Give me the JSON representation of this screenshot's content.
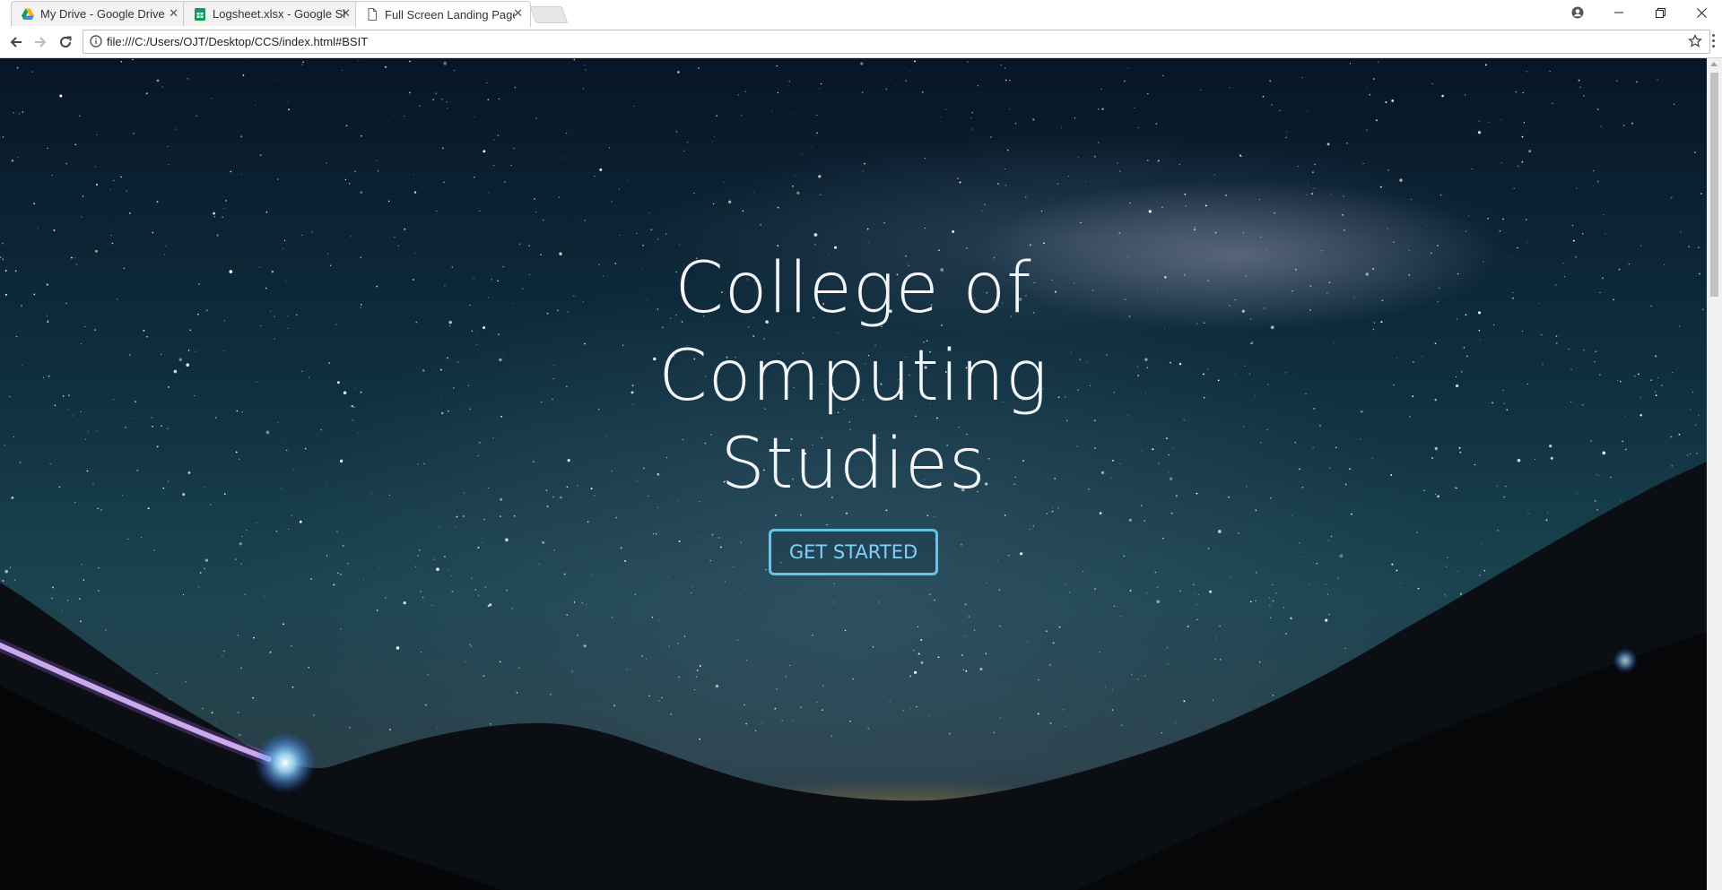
{
  "tabs": [
    {
      "title": "My Drive - Google Drive",
      "icon": "google-drive-icon"
    },
    {
      "title": "Logsheet.xlsx - Google Sheets",
      "icon": "google-sheets-icon"
    },
    {
      "title": "Full Screen Landing Page",
      "icon": "document-icon",
      "active": true
    }
  ],
  "address_bar": {
    "url": "file:///C:/Users/OJT/Desktop/CCS/index.html#BSIT"
  },
  "hero": {
    "title": "College of Computing Studies",
    "button_label": "GET STARTED"
  },
  "colors": {
    "button_border": "#63c4f0",
    "button_text": "#7fd2f6",
    "title_text": "#f3f5f7"
  }
}
